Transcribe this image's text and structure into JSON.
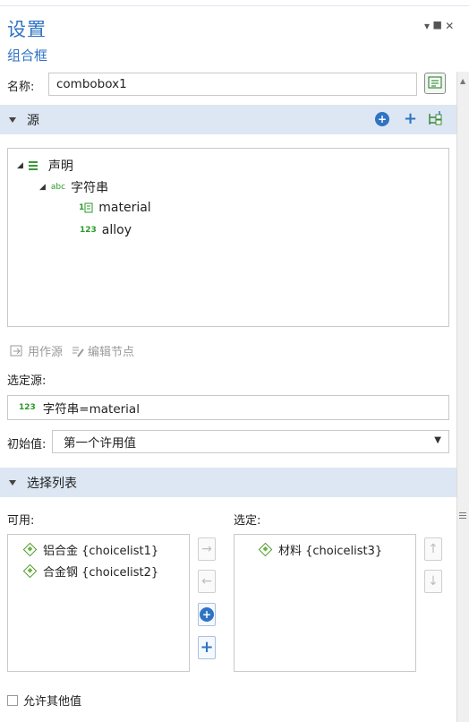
{
  "header": {
    "title": "设置",
    "pin_controls": "▾ ⯀ ✕",
    "subtitle": "组合框"
  },
  "name_row": {
    "label": "名称:",
    "value": "combobox1"
  },
  "source_section": {
    "title": "源",
    "tree": [
      {
        "label": "声明"
      },
      {
        "icon_text": "abc",
        "label": "字符串"
      },
      {
        "icon_text": "1",
        "label": "material"
      },
      {
        "icon_text": "123",
        "label": "alloy"
      }
    ],
    "use_as_source": "用作源",
    "edit_node": "编辑节点",
    "selected_source_label": "选定源:",
    "selected_source_icon": "123",
    "selected_source_value": "字符串=material",
    "initial_label": "初始值:",
    "initial_value": "第一个许用值"
  },
  "choice_section": {
    "title": "选择列表",
    "available_label": "可用:",
    "selected_label": "选定:",
    "available": [
      "铝合金 {choicelist1}",
      "合金钢 {choicelist2}"
    ],
    "selected": [
      "材料 {choicelist3}"
    ]
  },
  "footer": {
    "allow_other": "允许其他值"
  },
  "colors": {
    "accent": "#2f73c3",
    "section_bg": "#dde7f3",
    "green": "#3a9a3a"
  }
}
